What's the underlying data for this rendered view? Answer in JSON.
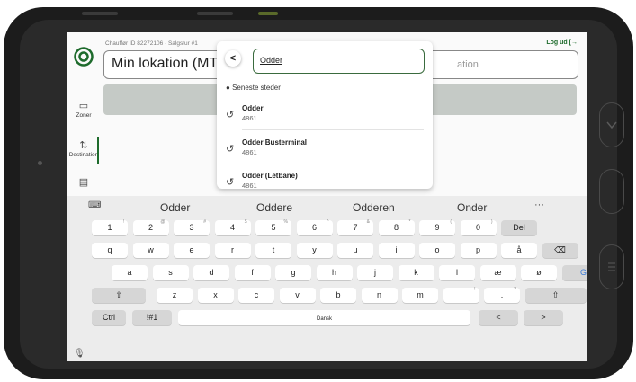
{
  "header": {
    "driver_info": "Chauffør ID 82272106 · Salgstur #1",
    "logout": "Log ud",
    "logout_icon": "logout-arrow-icon",
    "location_value": "Min lokation (MT",
    "destination_placeholder": "ation"
  },
  "sidebar": {
    "items": [
      {
        "label": "Zoner",
        "icon": "ticket-icon"
      },
      {
        "label": "Destination",
        "icon": "route-icon"
      },
      {
        "label": "",
        "icon": "receipt-icon"
      }
    ]
  },
  "search": {
    "value": "Odder",
    "recent_header": "Seneste steder",
    "results": [
      {
        "name": "Odder",
        "zip": "4861"
      },
      {
        "name": "Odder Busterminal",
        "zip": "4861"
      },
      {
        "name": "Odder (Letbane)",
        "zip": "4861"
      }
    ]
  },
  "keyboard": {
    "suggestions": [
      "Odder",
      "Oddere",
      "Odderen",
      "Onder"
    ],
    "row1": [
      {
        "k": "1",
        "s": "!"
      },
      {
        "k": "2",
        "s": "@"
      },
      {
        "k": "3",
        "s": "#"
      },
      {
        "k": "4",
        "s": "$"
      },
      {
        "k": "5",
        "s": "%"
      },
      {
        "k": "6",
        "s": "^"
      },
      {
        "k": "7",
        "s": "&"
      },
      {
        "k": "8",
        "s": "*"
      },
      {
        "k": "9",
        "s": "("
      },
      {
        "k": "0",
        "s": ")"
      }
    ],
    "del": "Del",
    "row2": [
      "q",
      "w",
      "e",
      "r",
      "t",
      "y",
      "u",
      "i",
      "o",
      "p",
      "å"
    ],
    "row3": [
      "a",
      "s",
      "d",
      "f",
      "g",
      "h",
      "j",
      "k",
      "l",
      "æ",
      "ø"
    ],
    "go": "Gå",
    "row4": [
      "z",
      "x",
      "c",
      "v",
      "b",
      "n",
      "m"
    ],
    "row4_punct": [
      {
        "k": ",",
        "s": "!"
      },
      {
        "k": ".",
        "s": "?"
      }
    ],
    "ctrl": "Ctrl",
    "symbols": "!#1",
    "space": "Dansk"
  }
}
